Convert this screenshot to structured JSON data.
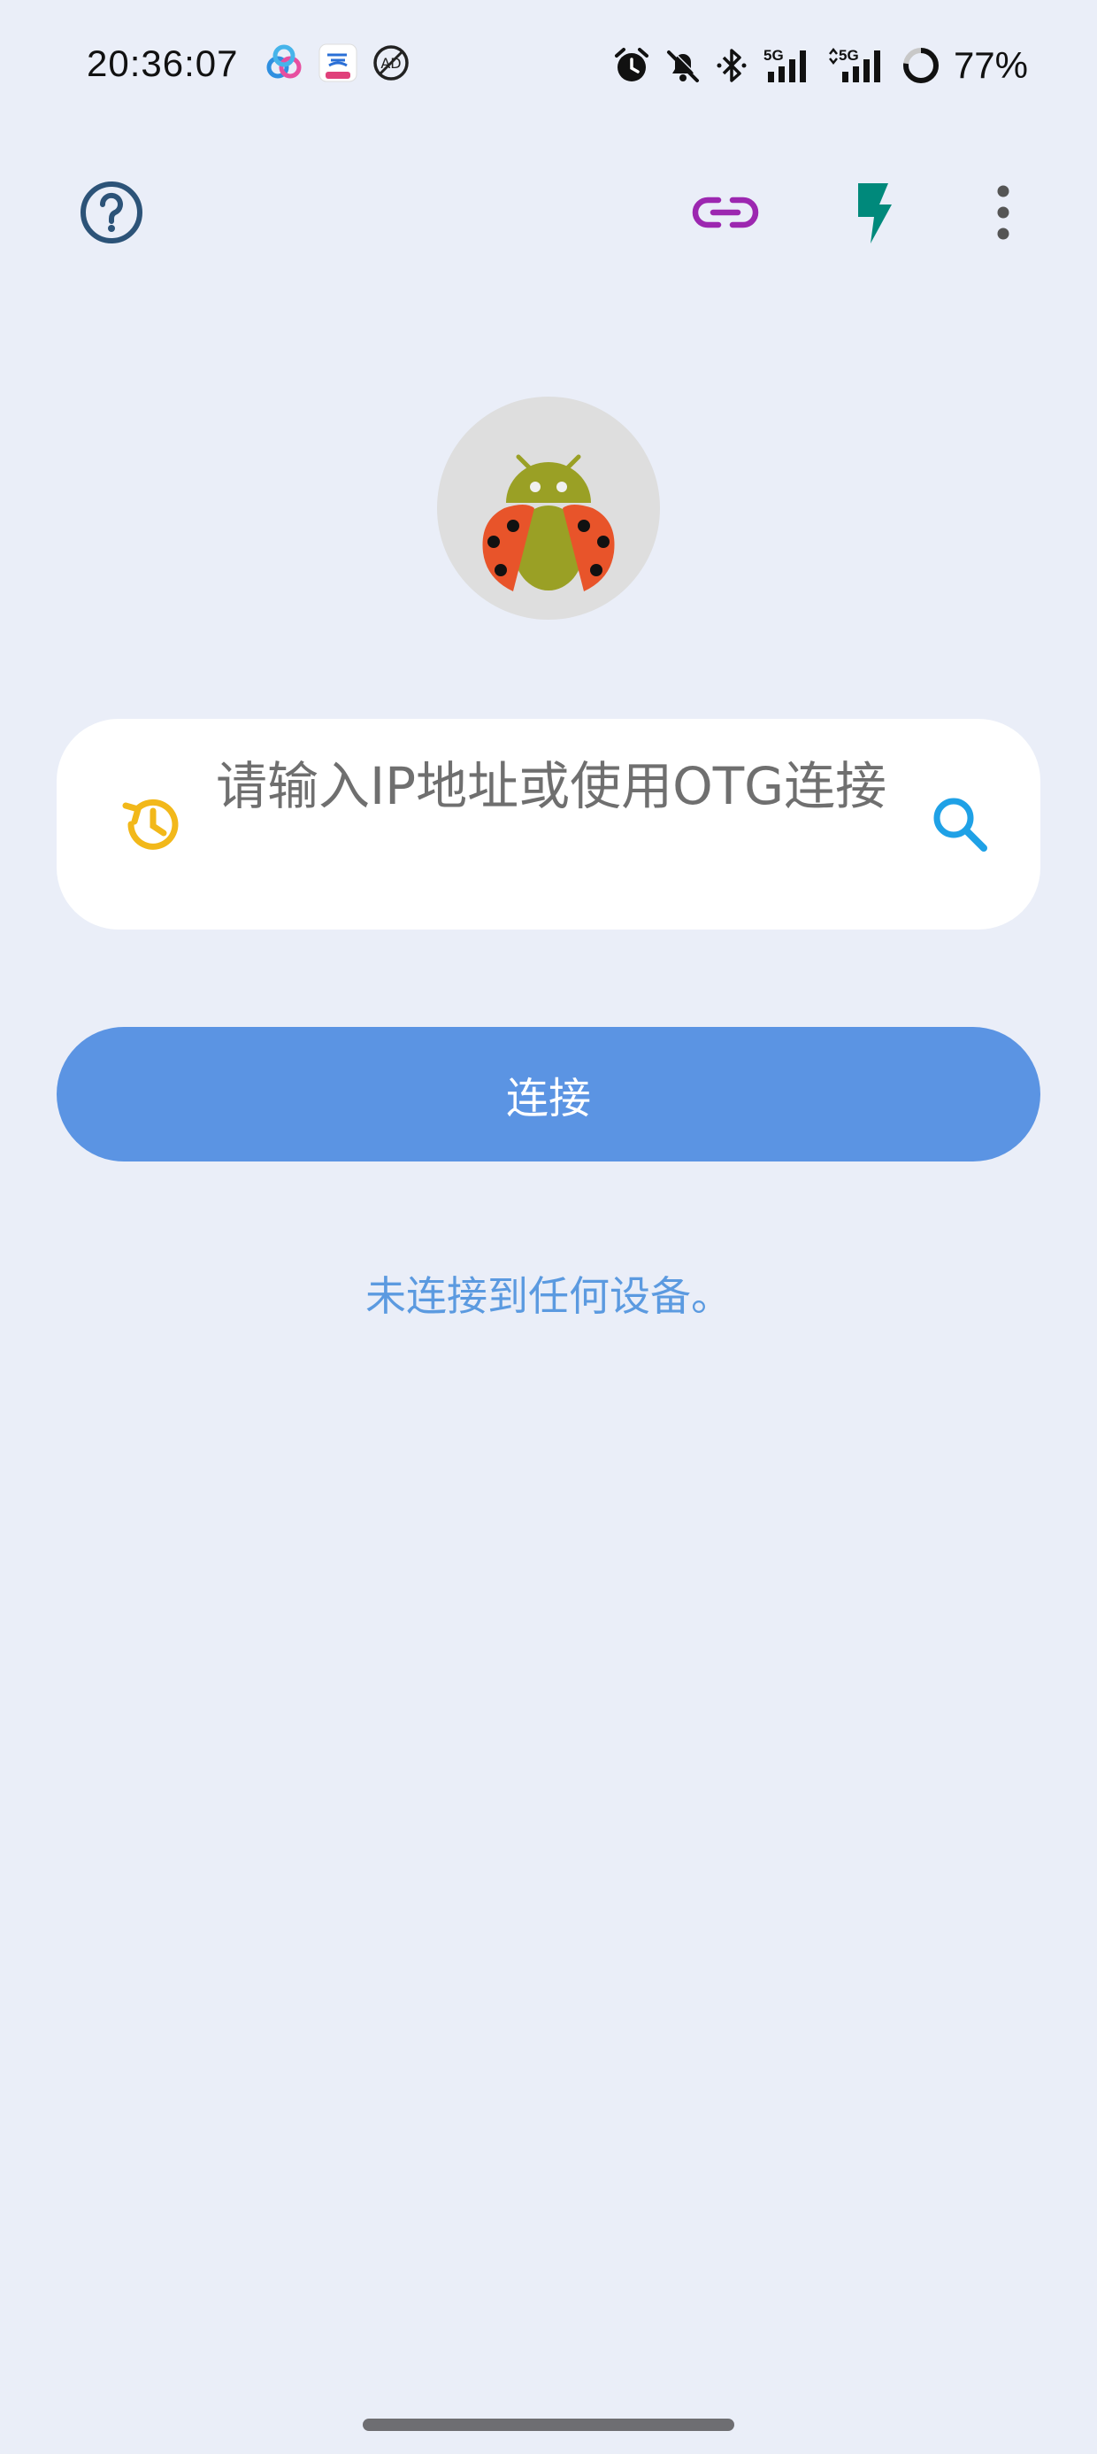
{
  "status_bar": {
    "time": "20:36:07",
    "battery_percent": "77%",
    "network_1": "5G",
    "network_2": "5G"
  },
  "toolbar": {
    "help_icon": "help-circle-icon",
    "link_icon": "link-icon",
    "flash_icon": "lightning-icon",
    "more_icon": "more-vertical-icon"
  },
  "colors": {
    "background": "#eaeef8",
    "primary": "#5b94e3",
    "help": "#2c5378",
    "link": "#9c27b0",
    "flash": "#00897b",
    "history": "#f2b81a",
    "search": "#1fa1e6",
    "status_text": "#5b9ae0"
  },
  "input": {
    "placeholder": "请输入IP地址或使用OTG连接",
    "value": ""
  },
  "connect_button": {
    "label": "连接"
  },
  "status_message": "未连接到任何设备。"
}
